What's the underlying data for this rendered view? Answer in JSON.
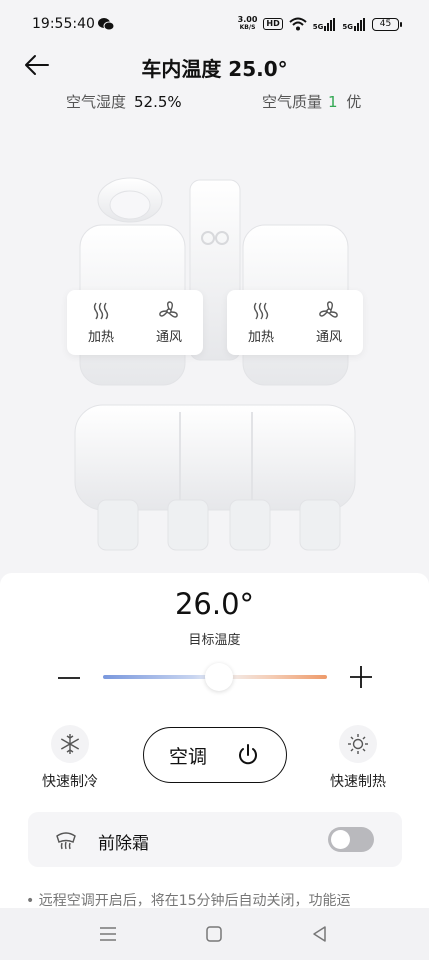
{
  "status_bar": {
    "time": "19:55:40",
    "speed_value": "3.00",
    "speed_unit": "KB/S",
    "hd": "HD",
    "signal1": "5G",
    "signal2": "5G",
    "battery": "45"
  },
  "header": {
    "title": "车内温度 25.0°",
    "humidity_label": "空气湿度",
    "humidity_value": "52.5%",
    "quality_label": "空气质量",
    "quality_value": "1",
    "quality_level": "优"
  },
  "seats": {
    "left": {
      "heat_label": "加热",
      "vent_label": "通风"
    },
    "right": {
      "heat_label": "加热",
      "vent_label": "通风"
    }
  },
  "climate": {
    "target_temp": "26.0°",
    "target_label": "目标温度",
    "slider_fraction": 0.52,
    "quick_cool_label": "快速制冷",
    "ac_label": "空调",
    "quick_heat_label": "快速制热",
    "defrost_label": "前除霜",
    "defrost_on": false,
    "note": "• 远程空调开启后，将在15分钟后自动关闭，功能运"
  },
  "colors": {
    "accent_good": "#33a853",
    "slider_cool": "#7a98dd",
    "slider_warm": "#ee9a6a"
  },
  "icons": {
    "back": "arrow-left-icon",
    "heat": "heat-waves-icon",
    "vent": "fan-icon",
    "cool": "snowflake-icon",
    "sun": "sun-icon",
    "power": "power-icon",
    "defrost": "defrost-icon"
  }
}
